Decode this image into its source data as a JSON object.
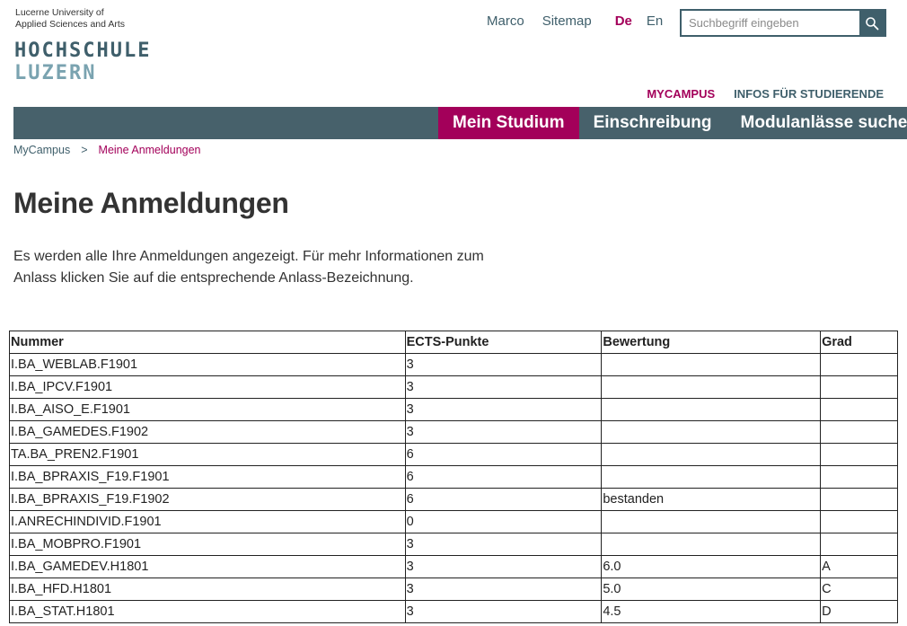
{
  "header": {
    "logo_small_line1": "Lucerne University of",
    "logo_small_line2": "Applied Sciences and Arts",
    "logo_line1": "HOCHSCHULE",
    "logo_line2": "LUZERN",
    "user": "Marco",
    "sitemap": "Sitemap",
    "lang_active": "De",
    "lang_other": "En",
    "search_placeholder": "Suchbegriff eingeben",
    "search_icon": "search-icon"
  },
  "subnav": {
    "active": "MYCAMPUS",
    "other": "INFOS FÜR STUDIERENDE"
  },
  "mainnav": {
    "items": [
      "Mein Studium",
      "Einschreibung",
      "Modulanlässe suchen"
    ],
    "active_index": 0
  },
  "breadcrumb": {
    "home": "MyCampus",
    "separator": ">",
    "current": "Meine Anmeldungen"
  },
  "page": {
    "title": "Meine Anmeldungen",
    "intro_line1": "Es werden alle Ihre Anmeldungen angezeigt. Für mehr Informationen zum",
    "intro_line2": "Anlass klicken Sie auf die entsprechende Anlass-Bezeichnung."
  },
  "table": {
    "headers": [
      "Nummer",
      "ECTS-Punkte",
      "Bewertung",
      "Grad"
    ],
    "rows": [
      [
        "I.BA_WEBLAB.F1901",
        "3",
        "",
        ""
      ],
      [
        "I.BA_IPCV.F1901",
        "3",
        "",
        ""
      ],
      [
        "I.BA_AISO_E.F1901",
        "3",
        "",
        ""
      ],
      [
        "I.BA_GAMEDES.F1902",
        "3",
        "",
        ""
      ],
      [
        "TA.BA_PREN2.F1901",
        "6",
        "",
        ""
      ],
      [
        "I.BA_BPRAXIS_F19.F1901",
        "6",
        "",
        ""
      ],
      [
        "I.BA_BPRAXIS_F19.F1902",
        "6",
        "bestanden",
        ""
      ],
      [
        "I.ANRECHINDIVID.F1901",
        "0",
        "",
        ""
      ],
      [
        "I.BA_MOBPRO.F1901",
        "3",
        "",
        ""
      ],
      [
        "I.BA_GAMEDEV.H1801",
        "3",
        "6.0",
        "A"
      ],
      [
        "I.BA_HFD.H1801",
        "3",
        "5.0",
        "C"
      ],
      [
        "I.BA_STAT.H1801",
        "3",
        "4.5",
        "D"
      ]
    ]
  },
  "colors": {
    "accent": "#a3005a",
    "nav_bg": "#47616b",
    "brand_dark": "#3f5f6b",
    "brand_light": "#7aa3b0"
  }
}
